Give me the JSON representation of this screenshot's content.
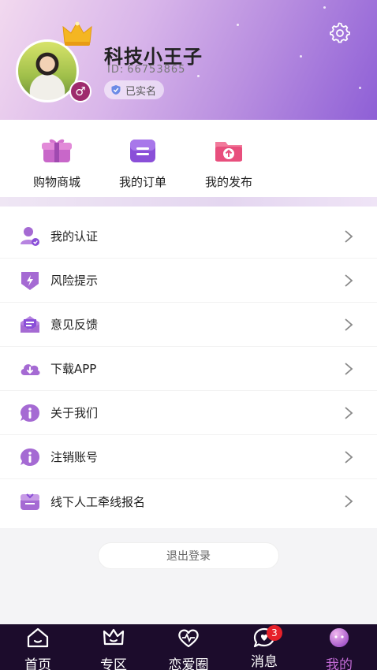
{
  "profile": {
    "name": "科技小王子",
    "id_label": "ID:",
    "id_value": "66753865",
    "verified_label": "已实名",
    "gender_symbol": "♂"
  },
  "quick_actions": [
    {
      "label": "购物商城",
      "icon": "gift-box-icon"
    },
    {
      "label": "我的订单",
      "icon": "order-list-icon"
    },
    {
      "label": "我的发布",
      "icon": "publish-upload-icon"
    }
  ],
  "menu": [
    {
      "label": "我的认证",
      "icon": "user-verify-icon"
    },
    {
      "label": "风险提示",
      "icon": "risk-warning-icon"
    },
    {
      "label": "意见反馈",
      "icon": "feedback-mail-icon"
    },
    {
      "label": "下载APP",
      "icon": "cloud-download-icon"
    },
    {
      "label": "关于我们",
      "icon": "info-icon"
    },
    {
      "label": "注销账号",
      "icon": "info-icon"
    },
    {
      "label": "线下人工牵线报名",
      "icon": "signup-icon"
    }
  ],
  "logout_label": "退出登录",
  "tabs": [
    {
      "label": "首页",
      "icon": "home-icon"
    },
    {
      "label": "专区",
      "icon": "crown-icon"
    },
    {
      "label": "恋爱圈",
      "icon": "heart-pulse-icon"
    },
    {
      "label": "消息",
      "icon": "chat-bubble-icon",
      "badge": "3"
    },
    {
      "label": "我的",
      "icon": "profile-face-icon",
      "active": true
    }
  ],
  "colors": {
    "accent": "#b05fd2",
    "tab_bar": "#1c0c2c",
    "badge": "#e6212a"
  }
}
